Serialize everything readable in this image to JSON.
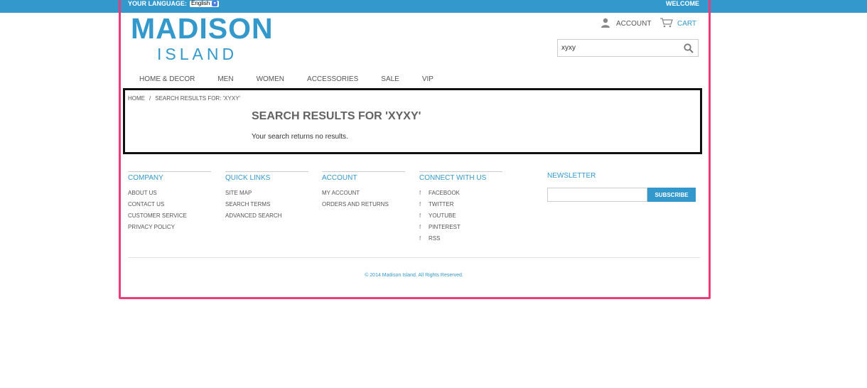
{
  "header": {
    "language_label": "YOUR LANGUAGE:",
    "language_value": "English",
    "welcome": "WELCOME",
    "logo_main": "MADISON",
    "logo_sub": "ISLAND",
    "account_label": "ACCOUNT",
    "cart_label": "CART"
  },
  "search": {
    "value": "xyxy",
    "icon": "search-icon"
  },
  "nav": {
    "items": [
      "HOME & DECOR",
      "MEN",
      "WOMEN",
      "ACCESSORIES",
      "SALE",
      "VIP"
    ]
  },
  "breadcrumb": {
    "home": "HOME",
    "separator": "/",
    "current": "SEARCH RESULTS FOR: 'XYXY'"
  },
  "results": {
    "title": "SEARCH RESULTS FOR 'XYXY'",
    "message": "Your search returns no results."
  },
  "footer": {
    "company": {
      "title": "COMPANY",
      "links": [
        "ABOUT US",
        "CONTACT US",
        "CUSTOMER SERVICE",
        "PRIVACY POLICY"
      ]
    },
    "quick_links": {
      "title": "QUICK LINKS",
      "links": [
        "SITE MAP",
        "SEARCH TERMS",
        "ADVANCED SEARCH"
      ]
    },
    "account": {
      "title": "ACCOUNT",
      "links": [
        "MY ACCOUNT",
        "ORDERS AND RETURNS"
      ]
    },
    "connect": {
      "title": "CONNECT WITH US",
      "icon": "f",
      "links": [
        "FACEBOOK",
        "TWITTER",
        "YOUTUBE",
        "PINTEREST",
        "RSS"
      ]
    },
    "newsletter": {
      "title": "NEWSLETTER",
      "input_value": "",
      "button": "SUBSCRIBE"
    },
    "copyright": "© 2014 Madison Island. All Rights Reserved."
  },
  "colors": {
    "brand": "#3399cc",
    "highlight_frame": "#ec3c7a",
    "results_frame": "#111111"
  }
}
